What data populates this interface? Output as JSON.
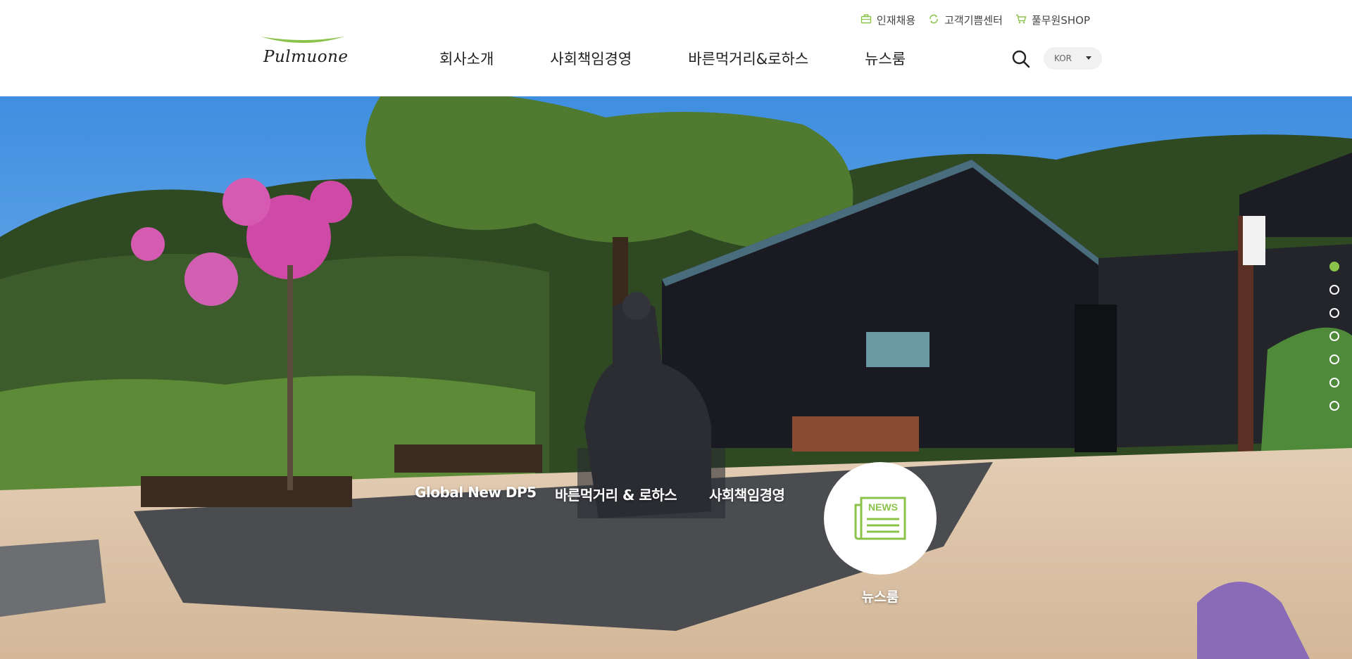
{
  "brand": {
    "logo_text": "Pulmuone",
    "accent": "#8bc34a"
  },
  "utility": [
    {
      "label": "인재채용",
      "icon": "briefcase-icon"
    },
    {
      "label": "고객기쁨센터",
      "icon": "recycle-icon"
    },
    {
      "label": "풀무원SHOP",
      "icon": "cart-icon"
    }
  ],
  "nav": [
    {
      "label": "회사소개"
    },
    {
      "label": "사회책임경영"
    },
    {
      "label": "바른먹거리&로하스"
    },
    {
      "label": "뉴스룸"
    }
  ],
  "lang": {
    "selected": "KOR"
  },
  "hero": {
    "quick_links": [
      {
        "label": "Global New DP5"
      },
      {
        "label": "바른먹거리 & 로하스"
      },
      {
        "label": "사회책임경영"
      }
    ],
    "news": {
      "label": "뉴스룸",
      "badge": "NEWS"
    },
    "pager": {
      "count": 7,
      "active_index": 0
    }
  }
}
